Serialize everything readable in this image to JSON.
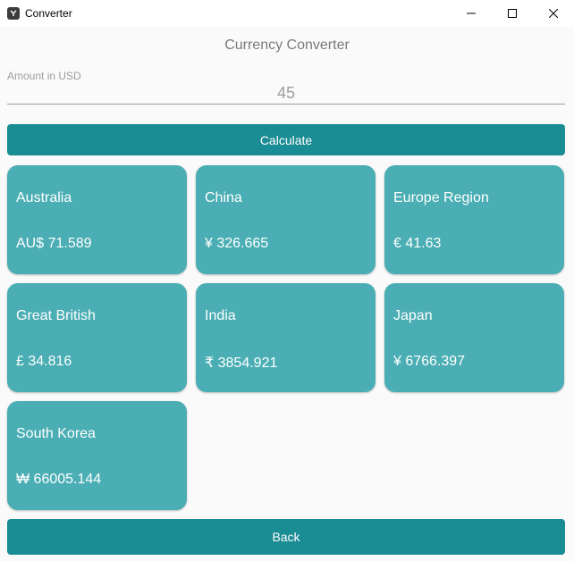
{
  "window": {
    "title": "Converter"
  },
  "heading": "Currency Converter",
  "amount": {
    "label": "Amount in USD",
    "value": "45"
  },
  "calculate_label": "Calculate",
  "back_label": "Back",
  "currencies": [
    {
      "name": "Australia",
      "value": "AU$ 71.589"
    },
    {
      "name": "China",
      "value": "¥ 326.665"
    },
    {
      "name": "Europe Region",
      "value": "€ 41.63"
    },
    {
      "name": "Great British",
      "value": "£ 34.816"
    },
    {
      "name": "India",
      "value": "₹ 3854.921"
    },
    {
      "name": "Japan",
      "value": "¥ 6766.397"
    },
    {
      "name": "South Korea",
      "value": "₩ 66005.144"
    }
  ],
  "colors": {
    "primary": "#1a8c93",
    "card": "#4aaeb4",
    "background": "#fafafa"
  },
  "icons": {
    "app": "app-logo-icon",
    "minimize": "minimize-icon",
    "maximize": "maximize-icon",
    "close": "close-icon"
  }
}
